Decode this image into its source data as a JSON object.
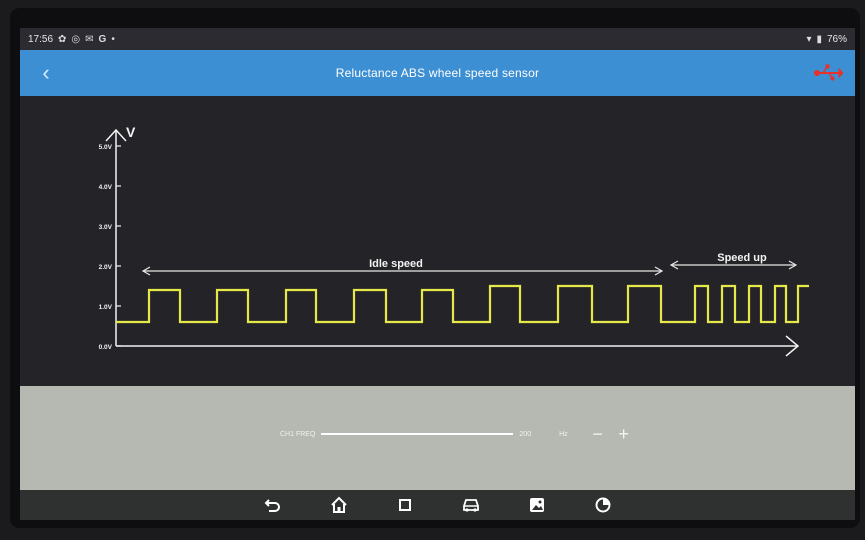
{
  "statusbar": {
    "time": "17:56",
    "left_icons": [
      "settings-icon",
      "target-icon",
      "mail-icon",
      "google-icon",
      "dot-icon"
    ],
    "battery": "76%",
    "right_icons": [
      "wifi-icon",
      "battery-icon"
    ]
  },
  "header": {
    "title": "Reluctance ABS wheel speed sensor",
    "back_icon": "chevron-left-icon",
    "usb_icon": "usb-icon",
    "usb_color": "#e8312b"
  },
  "chart_data": {
    "type": "line",
    "ylabel": "V",
    "ylim": [
      0,
      5
    ],
    "yticks": [
      "0.0V",
      "1.0V",
      "2.0V",
      "3.0V",
      "4.0V",
      "5.0V"
    ],
    "trace_color": "#e6e84a",
    "annotations": [
      {
        "text": "Idle speed"
      },
      {
        "text": "Speed up"
      }
    ],
    "series": [
      {
        "x": [
          0,
          3.3,
          3.3,
          6.4,
          6.4,
          10.1,
          10.1,
          13.2,
          13.2,
          17.0,
          17.0,
          20.0,
          20.0,
          23.8,
          23.8,
          27.0,
          27.0,
          30.6,
          30.6,
          33.7,
          33.7,
          37.4,
          37.4,
          40.4,
          40.4,
          44.2,
          44.2,
          47.6,
          47.6,
          51.2,
          51.2,
          54.5,
          54.5,
          57.9,
          57.9,
          59.2,
          59.2,
          60.6,
          60.6,
          61.9,
          61.9,
          63.3,
          63.3,
          64.5,
          64.5,
          65.9,
          65.9,
          67.0,
          67.0,
          68.2,
          68.2,
          69.3
        ],
        "y": [
          0.6,
          0.6,
          1.4,
          1.4,
          0.6,
          0.6,
          1.4,
          1.4,
          0.6,
          0.6,
          1.4,
          1.4,
          0.6,
          0.6,
          1.4,
          1.4,
          0.6,
          0.6,
          1.4,
          1.4,
          0.6,
          0.6,
          1.5,
          1.5,
          0.6,
          0.6,
          1.5,
          1.5,
          0.6,
          0.6,
          1.5,
          1.5,
          0.6,
          0.6,
          1.5,
          1.5,
          0.6,
          0.6,
          1.5,
          1.5,
          0.6,
          0.6,
          1.5,
          1.5,
          0.6,
          0.6,
          1.5,
          1.5,
          0.6,
          0.6,
          1.5,
          1.5
        ]
      }
    ]
  },
  "controls": {
    "freq_label": "CH1 FREQ",
    "freq_value": "200",
    "freq_unit": "Hz",
    "minus_label": "−",
    "plus_label": "+",
    "slider_fraction": 1.0
  },
  "navbar": {
    "items": [
      {
        "icon": "back-arrow-icon"
      },
      {
        "icon": "home-icon"
      },
      {
        "icon": "recent-apps-icon"
      },
      {
        "icon": "car-icon"
      },
      {
        "icon": "gallery-icon"
      },
      {
        "icon": "browser-icon"
      }
    ]
  }
}
